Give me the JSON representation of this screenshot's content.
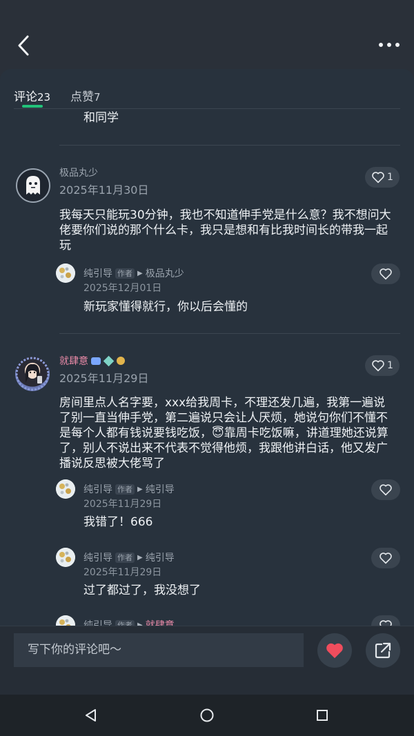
{
  "tabs": [
    {
      "label": "评论",
      "count": "23"
    },
    {
      "label": "点赞",
      "count": "7"
    }
  ],
  "partial_text": "和同学",
  "comments": [
    {
      "user": "极品丸少",
      "date": "2025年11月30日",
      "likes": "1",
      "lines": [
        "我每天只能玩30分钟，我也不知道伸手党是什么意？我不想问大",
        "佬要你们说的那个什么卡，我只是想和有比我时间长的带我一起",
        "玩"
      ],
      "replies": [
        {
          "user": "纯引导",
          "badge": "作者",
          "to": "极品丸少",
          "date": "2025年12月01日",
          "text": "新玩家懂得就行，你以后会懂的"
        }
      ]
    },
    {
      "user": "就肆意",
      "date": "2025年11月29日",
      "likes": "1",
      "lines": [
        "房间里点人名字要，xxx给我周卡，不理还发几遍，我第一遍说",
        "了别一直当伸手党，第二遍说只会让人厌烦，她说句你们不懂不",
        "是每个人都有钱说要钱吃饭，😇靠周卡吃饭嘛，讲道理她还说算",
        "了，别人不说出来不代表不觉得他烦，我跟他讲白话，他又发广",
        "播说反思被大佬骂了"
      ],
      "replies": [
        {
          "user": "纯引导",
          "badge": "作者",
          "to": "纯引导",
          "date": "2025年11月29日",
          "text": "我错了！666"
        },
        {
          "user": "纯引导",
          "badge": "作者",
          "to": "纯引导",
          "date": "2025年11月29日",
          "text": "过了都过了，我没想了"
        },
        {
          "user": "纯引导",
          "badge": "作者",
          "to": "就肆意",
          "date": "",
          "text": ""
        }
      ]
    }
  ],
  "input_placeholder": "写下你的评论吧～",
  "colors": {
    "accent_green": "#22c27a",
    "heart_red": "#f04d5d",
    "name_pink": "#e98aa8"
  }
}
